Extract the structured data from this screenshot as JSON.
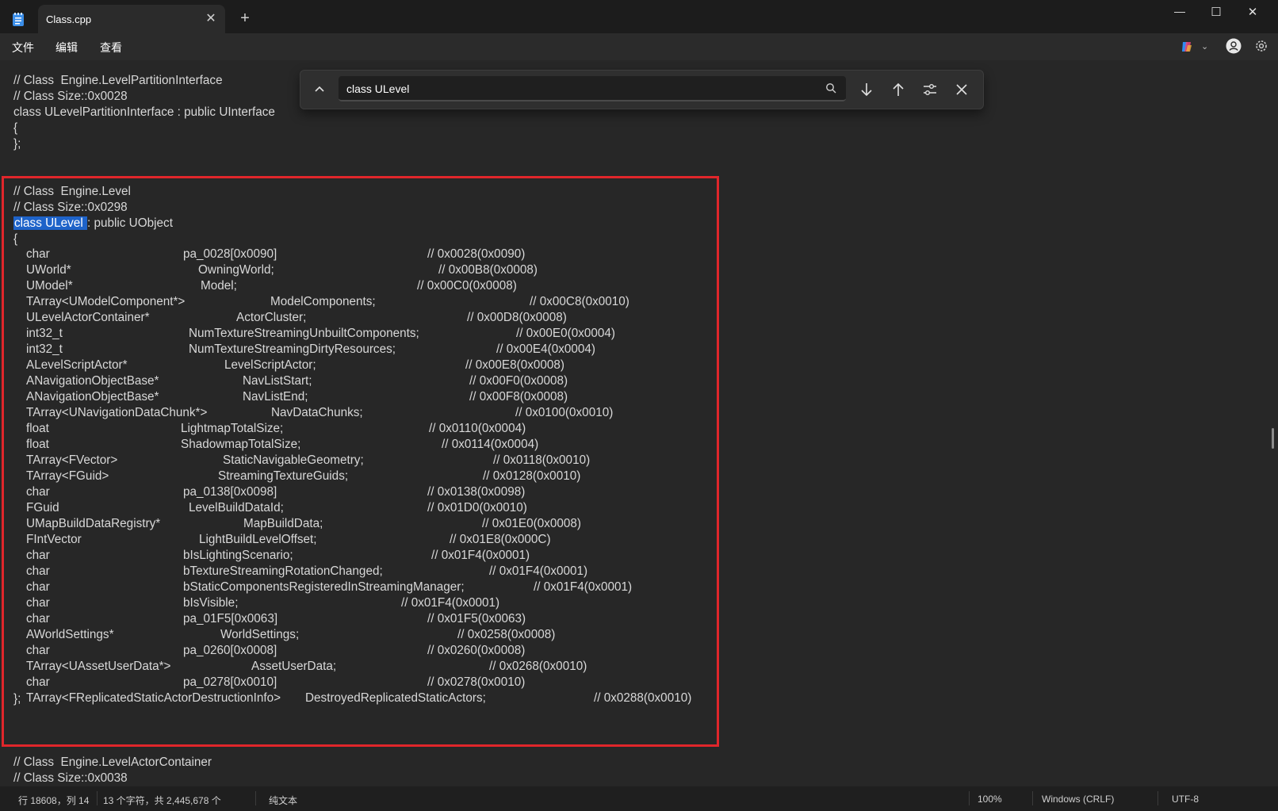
{
  "window": {
    "tab_title": "Class.cpp",
    "tab_close": "✕",
    "new_tab": "+",
    "minimize": "—",
    "maximize": "☐",
    "close": "✕"
  },
  "menu": {
    "file": "文件",
    "edit": "编辑",
    "view": "查看"
  },
  "find": {
    "query": "class ULevel"
  },
  "editor": {
    "block1": [
      "// Class  Engine.LevelPartitionInterface",
      "// Class Size::0x0028",
      "class ULevelPartitionInterface : public UInterface",
      "{",
      "};"
    ],
    "level_header": [
      "// Class  Engine.Level",
      "// Class Size::0x0298"
    ],
    "level_decl_highlight": "class ULevel ",
    "level_decl_rest": ": public UObject",
    "open_brace": "{",
    "members": [
      {
        "type": "char",
        "name": "pa_0028[0x0090]",
        "comment": "// 0x0028(0x0090)"
      },
      {
        "type": "UWorld*",
        "name": "OwningWorld;",
        "comment": "// 0x00B8(0x0008)"
      },
      {
        "type": "UModel*",
        "name": "Model;",
        "comment": "// 0x00C0(0x0008)"
      },
      {
        "type": "TArray<UModelComponent*>",
        "name": "ModelComponents;",
        "comment": "// 0x00C8(0x0010)"
      },
      {
        "type": "ULevelActorContainer*",
        "name": "ActorCluster;",
        "comment": "// 0x00D8(0x0008)"
      },
      {
        "type": "int32_t",
        "name": "NumTextureStreamingUnbuiltComponents;",
        "comment": "// 0x00E0(0x0004)"
      },
      {
        "type": "int32_t",
        "name": "NumTextureStreamingDirtyResources;",
        "comment": "// 0x00E4(0x0004)"
      },
      {
        "type": "ALevelScriptActor*",
        "name": "LevelScriptActor;",
        "comment": "// 0x00E8(0x0008)"
      },
      {
        "type": "ANavigationObjectBase*",
        "name": "NavListStart;",
        "comment": "// 0x00F0(0x0008)"
      },
      {
        "type": "ANavigationObjectBase*",
        "name": "NavListEnd;",
        "comment": "// 0x00F8(0x0008)"
      },
      {
        "type": "TArray<UNavigationDataChunk*>",
        "name": "NavDataChunks;",
        "comment": "// 0x0100(0x0010)"
      },
      {
        "type": "float",
        "name": "LightmapTotalSize;",
        "comment": "// 0x0110(0x0004)"
      },
      {
        "type": "float",
        "name": "ShadowmapTotalSize;",
        "comment": "// 0x0114(0x0004)"
      },
      {
        "type": "TArray<FVector>",
        "name": "StaticNavigableGeometry;",
        "comment": "// 0x0118(0x0010)"
      },
      {
        "type": "TArray<FGuid>",
        "name": "StreamingTextureGuids;",
        "comment": "// 0x0128(0x0010)"
      },
      {
        "type": "char",
        "name": "pa_0138[0x0098]",
        "comment": "// 0x0138(0x0098)"
      },
      {
        "type": "FGuid",
        "name": "LevelBuildDataId;",
        "comment": "// 0x01D0(0x0010)"
      },
      {
        "type": "UMapBuildDataRegistry*",
        "name": "MapBuildData;",
        "comment": "// 0x01E0(0x0008)"
      },
      {
        "type": "FIntVector",
        "name": "LightBuildLevelOffset;",
        "comment": "// 0x01E8(0x000C)"
      },
      {
        "type": "char",
        "name": "bIsLightingScenario;",
        "comment": "// 0x01F4(0x0001)"
      },
      {
        "type": "char",
        "name": "bTextureStreamingRotationChanged;",
        "comment": "// 0x01F4(0x0001)"
      },
      {
        "type": "char",
        "name": "bStaticComponentsRegisteredInStreamingManager;",
        "comment": "// 0x01F4(0x0001)"
      },
      {
        "type": "char",
        "name": "bIsVisible;",
        "comment": "// 0x01F4(0x0001)"
      },
      {
        "type": "char",
        "name": "pa_01F5[0x0063]",
        "comment": "// 0x01F5(0x0063)"
      },
      {
        "type": "AWorldSettings*",
        "name": "WorldSettings;",
        "comment": "// 0x0258(0x0008)"
      },
      {
        "type": "char",
        "name": "pa_0260[0x0008]",
        "comment": "// 0x0260(0x0008)"
      },
      {
        "type": "TArray<UAssetUserData*>",
        "name": "AssetUserData;",
        "comment": "// 0x0268(0x0010)"
      },
      {
        "type": "char",
        "name": "pa_0278[0x0010]",
        "comment": "// 0x0278(0x0010)"
      },
      {
        "type": "TArray<FReplicatedStaticActorDestructionInfo>",
        "name": "DestroyedReplicatedStaticActors;",
        "comment": "// 0x0288(0x0010)"
      }
    ],
    "close_brace": "};",
    "block3": [
      "// Class  Engine.LevelActorContainer",
      "// Class Size::0x0038"
    ]
  },
  "status": {
    "position": "行 18608，列 14",
    "selection": "13 个字符，共 2,445,678 个",
    "format": "纯文本",
    "zoom": "100%",
    "line_ending": "Windows (CRLF)",
    "encoding": "UTF-8"
  },
  "colors": {
    "background": "#272727",
    "titlebar": "#1c1c1c",
    "highlight": "#1e63c9",
    "annotation_box": "#e0262b"
  }
}
